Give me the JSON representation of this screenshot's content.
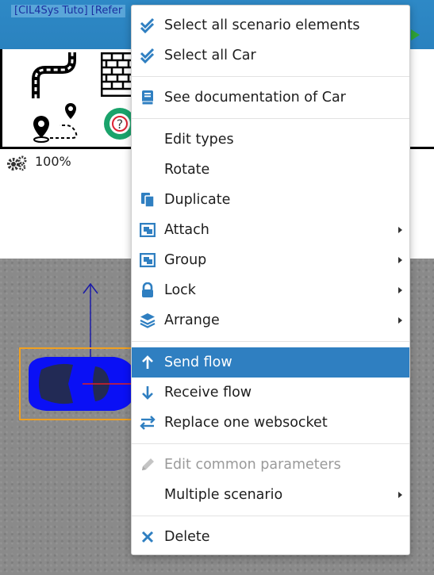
{
  "app": {
    "title_tab": "[CIL4Sys Tuto] [Refer"
  },
  "status": {
    "zoom": "100%"
  },
  "colors": {
    "accent": "#2f7fc1",
    "icon_blue": "#2f7fc1",
    "car_blue": "#0000ff",
    "selection_orange": "#f0a020"
  },
  "context_menu": {
    "select_all_scenario": "Select all scenario elements",
    "select_all_car": "Select all Car",
    "see_doc": "See documentation of Car",
    "edit_types": "Edit types",
    "rotate": "Rotate",
    "duplicate": "Duplicate",
    "attach": "Attach",
    "group": "Group",
    "lock": "Lock",
    "arrange": "Arrange",
    "send_flow": "Send flow",
    "receive_flow": "Receive flow",
    "replace_websocket": "Replace one websocket",
    "edit_common": "Edit common parameters",
    "multiple_scenario": "Multiple scenario",
    "delete": "Delete"
  },
  "icons": {
    "select_all_scenario": "double-check-icon",
    "select_all_car": "double-check-icon",
    "see_doc": "book-icon",
    "duplicate": "copy-icon",
    "attach": "attach-icon",
    "group": "group-icon",
    "lock": "lock-icon",
    "arrange": "layers-icon",
    "send_flow": "arrow-up-icon",
    "receive_flow": "arrow-down-icon",
    "replace_websocket": "swap-arrows-icon",
    "edit_common": "pencil-icon",
    "delete": "close-icon"
  }
}
